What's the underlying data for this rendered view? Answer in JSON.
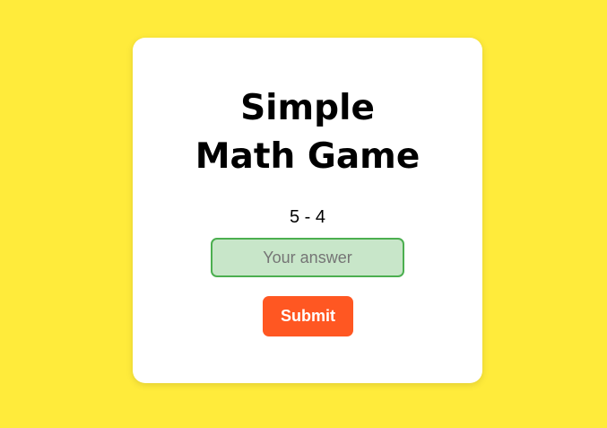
{
  "game": {
    "title": "Simple Math Game",
    "question": "5 - 4",
    "answer_value": "",
    "answer_placeholder": "Your answer",
    "submit_label": "Submit"
  },
  "colors": {
    "page_background": "#ffeb3b",
    "card_background": "#ffffff",
    "input_background": "#c8e6c9",
    "input_border": "#4caf50",
    "submit_background": "#ff5722",
    "submit_text": "#ffffff"
  }
}
